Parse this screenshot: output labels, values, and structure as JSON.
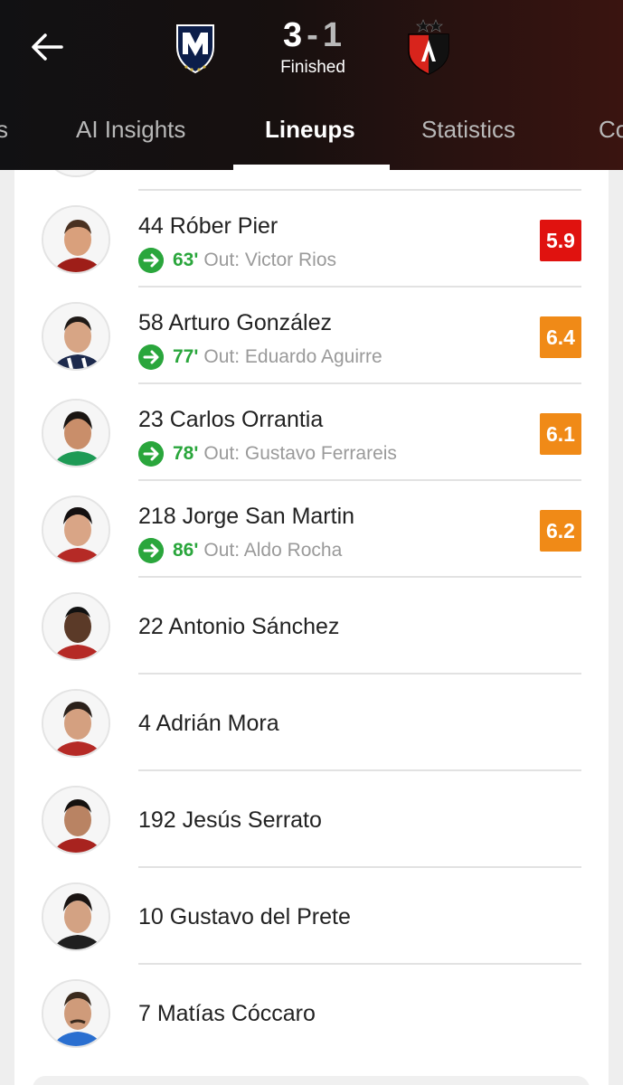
{
  "header": {
    "score_home": "3",
    "score_sep": "-",
    "score_away": "1",
    "status": "Finished"
  },
  "tabs": [
    {
      "label": "s"
    },
    {
      "label": "AI Insights"
    },
    {
      "label": "Lineups"
    },
    {
      "label": "Statistics"
    },
    {
      "label": "Co"
    }
  ],
  "colors": {
    "sub_green": "#2aa63c",
    "rating_red": "#e0120f",
    "rating_orange": "#f08a17"
  },
  "players": [
    {
      "name": "44 Róber Pier",
      "sub_minute": "63'",
      "sub_out": "Out: Victor Rios",
      "rating": "5.9"
    },
    {
      "name": "58 Arturo González",
      "sub_minute": "77'",
      "sub_out": "Out: Eduardo Aguirre",
      "rating": "6.4"
    },
    {
      "name": "23 Carlos Orrantia",
      "sub_minute": "78'",
      "sub_out": "Out: Gustavo Ferrareis",
      "rating": "6.1"
    },
    {
      "name": "218 Jorge San Martin",
      "sub_minute": "86'",
      "sub_out": "Out: Aldo Rocha",
      "rating": "6.2"
    },
    {
      "name": "22 Antonio Sánchez"
    },
    {
      "name": "4 Adrián Mora"
    },
    {
      "name": "192 Jesús Serrato"
    },
    {
      "name": "10 Gustavo del Prete"
    },
    {
      "name": "7 Matías Cóccaro"
    }
  ]
}
